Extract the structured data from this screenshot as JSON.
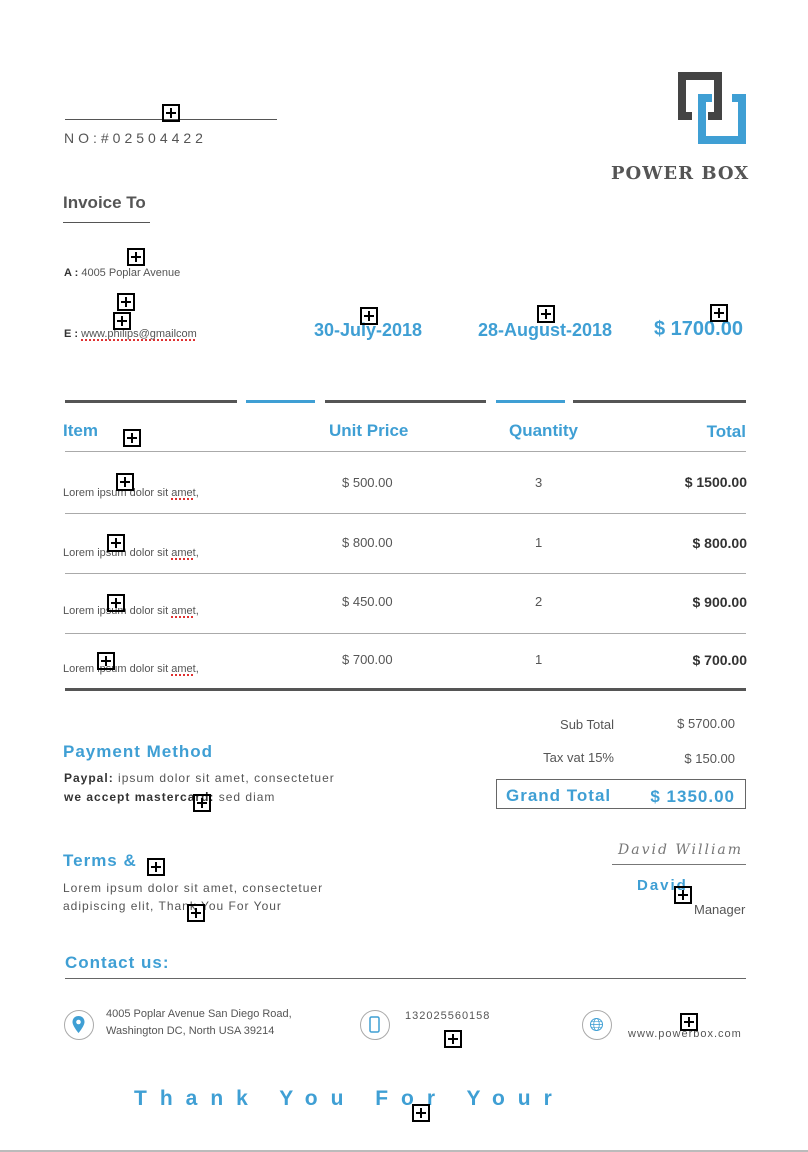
{
  "invoice": {
    "number": "NO:#02504422",
    "invoice_to_label": "Invoice To",
    "address_label": "A :",
    "address_value": "4005 Poplar Avenue",
    "email_label": "E :",
    "email_value": "www.philips@gmailcom",
    "invoice_date": "30-July-2018",
    "due_date": "28-August-2018",
    "amount_due": "$ 1700.00"
  },
  "brand": {
    "name": "POWER BOX",
    "accent_color": "#3f9fd4",
    "dark_color": "#444444"
  },
  "table": {
    "headers": [
      "Item",
      "Unit Price",
      "Quantity",
      "Total"
    ],
    "rows": [
      {
        "item": "Lorem ipsum dolor sit amet,",
        "unit_price": "$ 500.00",
        "quantity": "3",
        "total": "$ 1500.00"
      },
      {
        "item": "Lorem ipsum dolor sit amet,",
        "unit_price": "$ 800.00",
        "quantity": "1",
        "total": "$ 800.00"
      },
      {
        "item": "Lorem ipsum dolor sit amet,",
        "unit_price": "$ 450.00",
        "quantity": "2",
        "total": "$ 900.00"
      },
      {
        "item": "Lorem ipsum dolor sit amet,",
        "unit_price": "$ 700.00",
        "quantity": "1",
        "total": "$ 700.00"
      }
    ]
  },
  "totals": {
    "sub_total_label": "Sub Total",
    "sub_total_value": "$ 5700.00",
    "tax_label": "Tax vat 15%",
    "tax_value": "$ 150.00",
    "grand_total_label": "Grand Total",
    "grand_total_value": "$ 1350.00"
  },
  "payment": {
    "title": "Payment Method",
    "line1_label": "Paypal:",
    "line1_text": " ipsum dolor sit amet, consectetuer",
    "line2_label": "we accept mastercard:",
    "line2_text": " sed diam"
  },
  "terms": {
    "title": "Terms &",
    "line1": "Lorem ipsum dolor sit amet, consectetuer",
    "line2": "adipiscing elit, Thank You For Your"
  },
  "signature": {
    "script": "David William",
    "name": "David",
    "role": "Manager"
  },
  "contact": {
    "title": "Contact us:",
    "address_line1": "4005 Poplar Avenue San Diego Road,",
    "address_line2": "Washington DC, North USA 39214",
    "phone": "132025560158",
    "website": "www.powerbox.com"
  },
  "footer": {
    "thank_you": "Thank You For Your"
  }
}
